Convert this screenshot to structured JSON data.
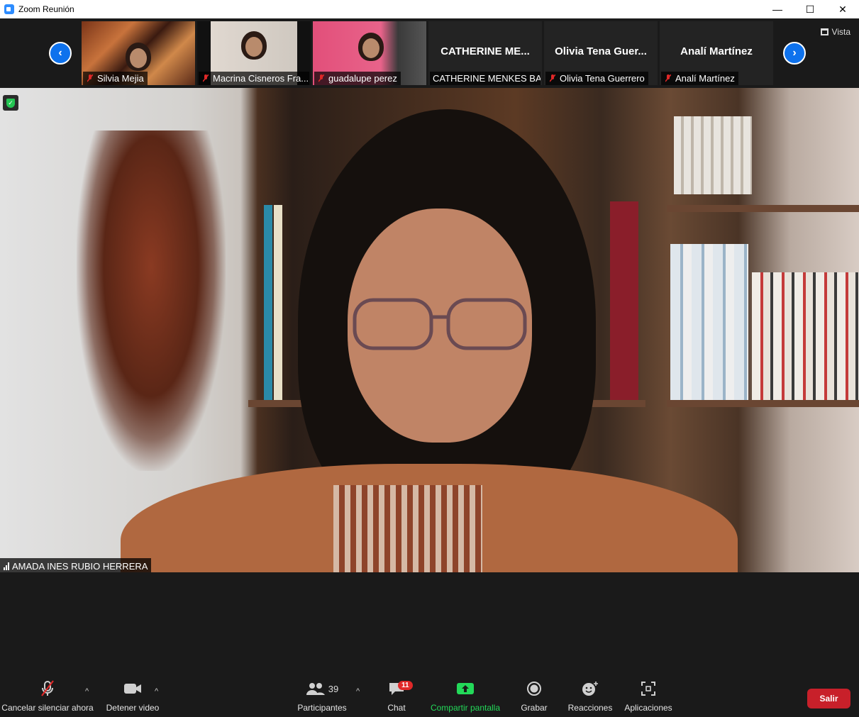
{
  "window": {
    "title": "Zoom Reunión",
    "controls": {
      "minimize": "—",
      "maximize": "☐",
      "close": "✕"
    }
  },
  "gallery": {
    "view_button": "Vista",
    "prev_icon": "chevron-left-icon",
    "next_icon": "chevron-right-icon",
    "participants": [
      {
        "name": "Silvia Mejia",
        "muted": true,
        "video_on": true
      },
      {
        "name": "Macrina Cisneros Fra...",
        "muted": true,
        "video_on": true
      },
      {
        "name": "guadalupe perez",
        "muted": true,
        "video_on": true
      },
      {
        "name": "CATHERINE MENKES BA...",
        "display_name": "CATHERINE ME...",
        "muted": false,
        "video_on": false
      },
      {
        "name": "Olivia Tena Guerrero",
        "display_name": "Olivia Tena Guer...",
        "muted": true,
        "video_on": false
      },
      {
        "name": "Analí Martínez",
        "display_name": "Analí Martínez",
        "muted": true,
        "video_on": false
      }
    ]
  },
  "main_video": {
    "speaker_name": "AMADA INES RUBIO HERRERA",
    "encryption_icon": "shield-check-icon"
  },
  "toolbar": {
    "mute_label": "Cancelar silenciar ahora",
    "video_label": "Detener video",
    "participants_label": "Participantes",
    "participants_count": "39",
    "chat_label": "Chat",
    "chat_badge": "11",
    "share_label": "Compartir pantalla",
    "record_label": "Grabar",
    "reactions_label": "Reacciones",
    "apps_label": "Aplicaciones",
    "leave_label": "Salir"
  },
  "colors": {
    "accent": "#0e72ed",
    "share_green": "#23d959",
    "leave_red": "#c8202a",
    "badge_red": "#e02828",
    "muted_red": "#e02828"
  }
}
